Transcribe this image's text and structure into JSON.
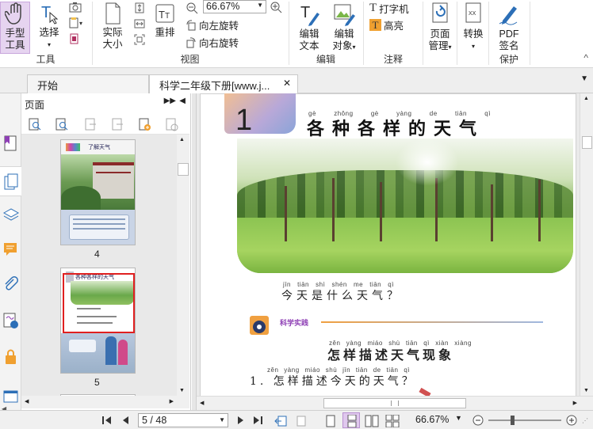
{
  "ribbon": {
    "tools": {
      "hand_label1": "手型",
      "hand_label2": "工具",
      "select_label": "选择",
      "group_label": "工具"
    },
    "view": {
      "actual_label1": "实际",
      "actual_label2": "大小",
      "reflow_label": "重排",
      "zoom_value": "66.67%",
      "rotate_left": "向左旋转",
      "rotate_right": "向右旋转",
      "group_label": "视图"
    },
    "edit": {
      "edit_text1": "编辑",
      "edit_text2": "文本",
      "edit_obj1": "编辑",
      "edit_obj2": "对象",
      "group_label": "编辑"
    },
    "annot": {
      "typewriter": "打字机",
      "highlight": "高亮",
      "group_label": "注释"
    },
    "page_mgmt1": "页面",
    "page_mgmt2": "管理",
    "convert": "转换",
    "pdf_sign1": "PDF",
    "pdf_sign2": "签名",
    "protect_label": "保护"
  },
  "tabs": [
    {
      "label": "开始"
    },
    {
      "label": "科学二年级下册[www.j..."
    }
  ],
  "panel": {
    "title": "页面",
    "thumbs": [
      {
        "page": "4",
        "title": "了解天气"
      },
      {
        "page": "5",
        "title": "各种各样的天气"
      }
    ]
  },
  "document": {
    "lesson_number": "1",
    "title_pinyin": [
      "gè",
      "zhǒng",
      "gè",
      "yàng",
      "de",
      "tiān",
      "qì"
    ],
    "title_chars": "各种各样的天气",
    "question1_pinyin": [
      "jīn",
      "tiān",
      "shì",
      "shén",
      "me",
      "tiān",
      "qì"
    ],
    "question1": "今天是什么天气？",
    "section_badge": "科学实践",
    "subtitle_pinyin": [
      "zěn",
      "yàng",
      "miáo",
      "shù",
      "tiān",
      "qì",
      "xiàn",
      "xiàng"
    ],
    "subtitle": "怎样描述天气现象",
    "item1_pinyin": [
      "zěn",
      "yàng",
      "miáo",
      "shù",
      "jīn",
      "tiān",
      "de",
      "tiān",
      "qì"
    ],
    "item1": "1. 怎样描述今天的天气？"
  },
  "status": {
    "page_field": "5 / 48",
    "zoom": "66.67%"
  },
  "colors": {
    "accent_purple": "#9b5fc0",
    "icon_blue": "#2c6fb7",
    "highlight_orange": "#f0a030",
    "selection_red": "#e02020",
    "active_hand_bg": "#e6d4f0"
  }
}
